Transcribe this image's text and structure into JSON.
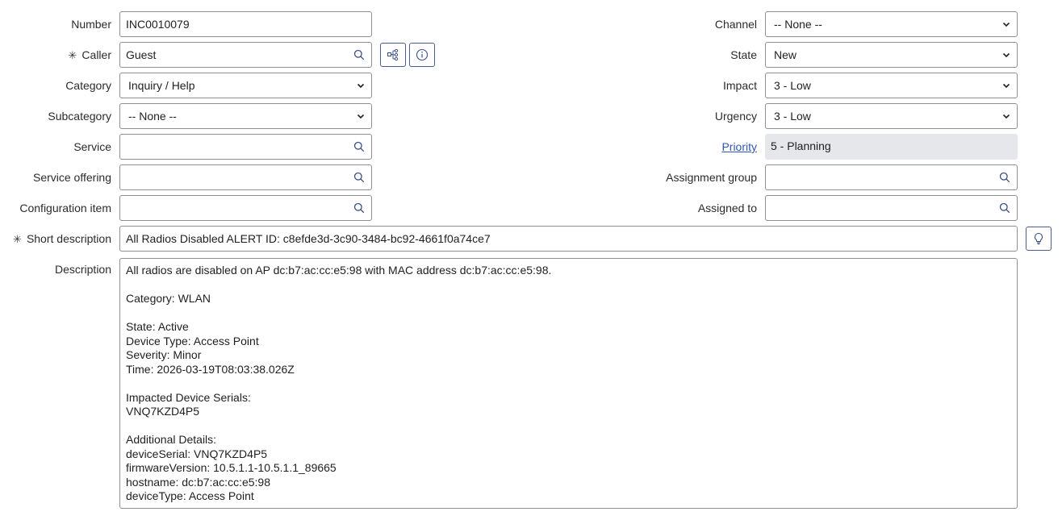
{
  "left_fields": {
    "number": {
      "label": "Number",
      "value": "INC0010079"
    },
    "caller": {
      "label": "Caller",
      "value": "Guest",
      "required": true
    },
    "category": {
      "label": "Category",
      "value": "Inquiry / Help"
    },
    "subcategory": {
      "label": "Subcategory",
      "value": "-- None --"
    },
    "service": {
      "label": "Service",
      "value": ""
    },
    "service_offering": {
      "label": "Service offering",
      "value": ""
    },
    "configuration_item": {
      "label": "Configuration item",
      "value": ""
    }
  },
  "right_fields": {
    "channel": {
      "label": "Channel",
      "value": "-- None --"
    },
    "state": {
      "label": "State",
      "value": "New"
    },
    "impact": {
      "label": "Impact",
      "value": "3 - Low"
    },
    "urgency": {
      "label": "Urgency",
      "value": "3 - Low"
    },
    "priority": {
      "label": "Priority",
      "value": "5 - Planning"
    },
    "assignment_group": {
      "label": "Assignment group",
      "value": ""
    },
    "assigned_to": {
      "label": "Assigned to",
      "value": ""
    }
  },
  "short_description": {
    "label": "Short description",
    "value": "All Radios Disabled ALERT ID: c8efde3d-3c90-3484-bc92-4661f0a74ce7",
    "required": true
  },
  "description": {
    "label": "Description",
    "value": "All radios are disabled on AP dc:b7:ac:cc:e5:98 with MAC address dc:b7:ac:cc:e5:98.\n\nCategory: WLAN\n\nState: Active\nDevice Type: Access Point\nSeverity: Minor\nTime: 2026-03-19T08:03:38.026Z\n\nImpacted Device Serials:\nVNQ7KZD4P5\n\nAdditional Details:\ndeviceSerial: VNQ7KZD4P5\nfirmwareVersion: 10.5.1.1-10.5.1.1_89665\nhostname: dc:b7:ac:cc:e5:98\ndeviceType: Access Point"
  },
  "icons": {
    "lookup": "search-icon",
    "dependency": "dependency-map-icon",
    "info": "info-icon",
    "suggest": "lightbulb-icon",
    "required": "asterisk-icon"
  },
  "colors": {
    "link": "#2e56b6",
    "button_border": "#4b5f8f",
    "readonly_bg": "#e6e7ea"
  }
}
